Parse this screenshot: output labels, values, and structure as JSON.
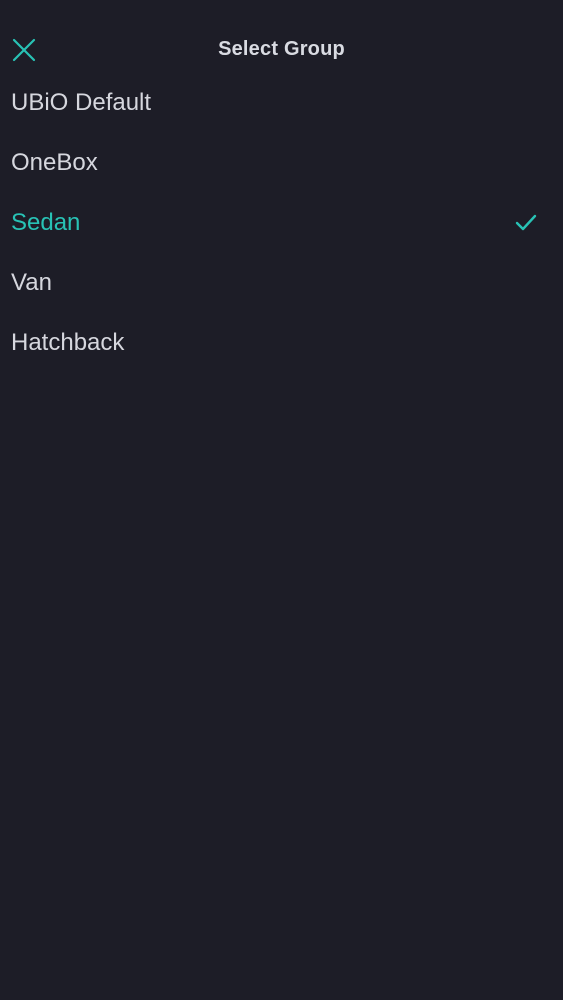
{
  "header": {
    "title": "Select Group",
    "close_icon": "close-icon"
  },
  "colors": {
    "background": "#1d1d27",
    "accent": "#28c2b5",
    "text": "#d6d7de"
  },
  "groups": {
    "selected_index": 2,
    "items": [
      {
        "label": "UBiO Default",
        "selected": false
      },
      {
        "label": "OneBox",
        "selected": false
      },
      {
        "label": "Sedan",
        "selected": true
      },
      {
        "label": "Van",
        "selected": false
      },
      {
        "label": "Hatchback",
        "selected": false
      }
    ]
  }
}
